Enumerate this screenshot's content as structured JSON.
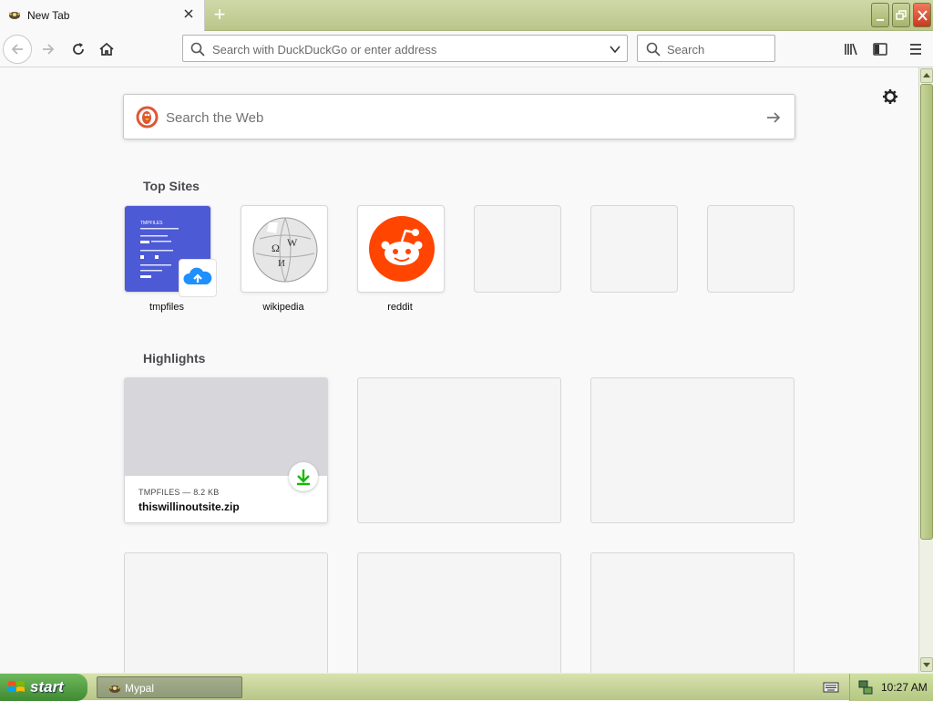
{
  "browser": {
    "tab_title": "New Tab",
    "new_tab_symbol": "+",
    "window_buttons": [
      "minimize-icon",
      "restore-icon",
      "close-icon"
    ]
  },
  "navbar": {
    "url_placeholder": "Search with DuckDuckGo or enter address",
    "search_placeholder": "Search",
    "icons": [
      "back-arrow-icon",
      "forward-arrow-icon",
      "reload-icon",
      "home-icon",
      "library-icon",
      "sidebar-icon",
      "menu-icon"
    ]
  },
  "newtab": {
    "web_search_placeholder": "Search the Web",
    "top_sites_title": "Top Sites",
    "top_sites": [
      {
        "label": "tmpfiles"
      },
      {
        "label": "wikipedia"
      },
      {
        "label": "reddit"
      },
      {
        "label": ""
      },
      {
        "label": ""
      },
      {
        "label": ""
      }
    ],
    "tmpfiles_thumb_title": "TMPFILES",
    "highlights_title": "Highlights",
    "highlights": [
      {
        "meta": "TMPFILES — 8.2 KB",
        "name": "thiswillinoutsite.zip"
      }
    ]
  },
  "taskbar": {
    "start_label": "start",
    "task_label": "Mypal",
    "clock": "10:27 AM"
  },
  "colors": {
    "reddit": "#ff4500",
    "tmpfiles": "#4d5ad6",
    "download_green": "#12bc00",
    "duckduckgo": "#de5833"
  }
}
